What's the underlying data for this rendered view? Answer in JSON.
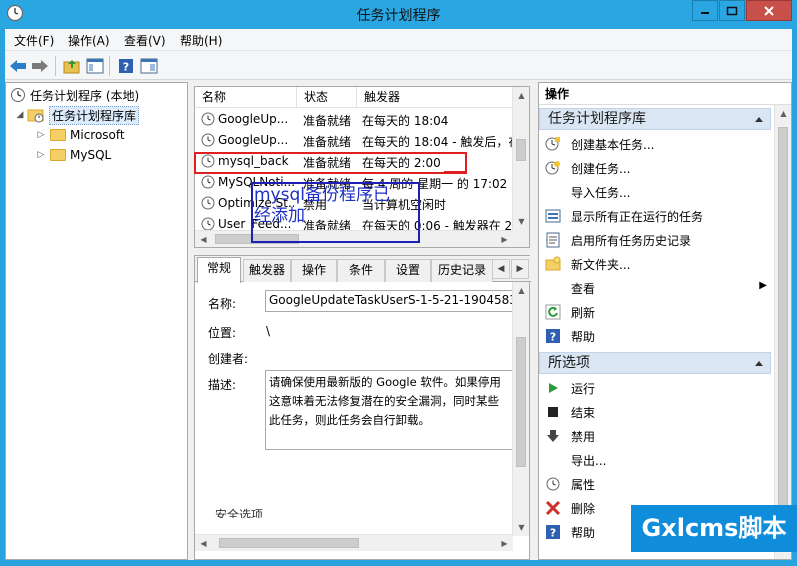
{
  "window": {
    "title": "任务计划程序",
    "accent": "#2aa6e2",
    "close_color": "#c7504a"
  },
  "menu": {
    "file": "文件(F)",
    "action": "操作(A)",
    "view": "查看(V)",
    "help": "帮助(H)"
  },
  "tree": {
    "root": "任务计划程序 (本地)",
    "library": "任务计划程序库",
    "children": [
      "Microsoft",
      "MySQL"
    ]
  },
  "tasklist": {
    "columns": [
      "名称",
      "状态",
      "触发器"
    ],
    "rows": [
      {
        "name": "GoogleUp...",
        "status": "准备就绪",
        "trigger": "在每天的 18:04"
      },
      {
        "name": "GoogleUp...",
        "status": "准备就绪",
        "trigger": "在每天的 18:04 - 触发后，在"
      },
      {
        "name": "mysql_back",
        "status": "准备就绪",
        "trigger": "在每天的 2:00"
      },
      {
        "name": "MySQLNoti...",
        "status": "准备就绪",
        "trigger": "每 4 周的 星期一 的 17:02 时"
      },
      {
        "name": "Optimize St...",
        "status": "禁用",
        "trigger": "当计算机空闲时"
      },
      {
        "name": "User_Feed...",
        "status": "准备就绪",
        "trigger": "在每天的 0:06 - 触发器在 2"
      }
    ]
  },
  "annotation": {
    "line1": "mysql备份程序已",
    "line2": "经添加",
    "red_color": "#e02020",
    "blue_color": "#1f1fb6"
  },
  "details": {
    "tabs": [
      "常规",
      "触发器",
      "操作",
      "条件",
      "设置",
      "历史记录"
    ],
    "name_label": "名称:",
    "name_value": "GoogleUpdateTaskUserS-1-5-21-1904583",
    "location_label": "位置:",
    "location_value": "\\",
    "author_label": "创建者:",
    "description_label": "描述:",
    "description_value": "请确保使用最新版的 Google 软件。如果停用这意味着无法修复潜在的安全漏洞，同时某些此任务，则此任务会自行卸载。",
    "security_label": "安全选项"
  },
  "actions": {
    "header": "操作",
    "section1": "任务计划程序库",
    "items1": [
      {
        "label": "创建基本任务...",
        "icon": "create-basic-task-icon"
      },
      {
        "label": "创建任务...",
        "icon": "create-task-icon"
      },
      {
        "label": "导入任务...",
        "icon": ""
      },
      {
        "label": "显示所有正在运行的任务",
        "icon": "running-tasks-icon"
      },
      {
        "label": "启用所有任务历史记录",
        "icon": "history-icon"
      },
      {
        "label": "新文件夹...",
        "icon": "new-folder-icon"
      },
      {
        "label": "查看",
        "icon": ""
      },
      {
        "label": "刷新",
        "icon": "refresh-icon"
      },
      {
        "label": "帮助",
        "icon": "help-icon"
      }
    ],
    "section2": "所选项",
    "items2": [
      {
        "label": "运行",
        "icon": "run-icon"
      },
      {
        "label": "结束",
        "icon": "end-icon"
      },
      {
        "label": "禁用",
        "icon": "disable-icon"
      },
      {
        "label": "导出...",
        "icon": ""
      },
      {
        "label": "属性",
        "icon": "properties-icon"
      },
      {
        "label": "删除",
        "icon": "delete-icon"
      },
      {
        "label": "帮助",
        "icon": "help-icon"
      }
    ]
  },
  "watermark": "Gxlcms脚本"
}
